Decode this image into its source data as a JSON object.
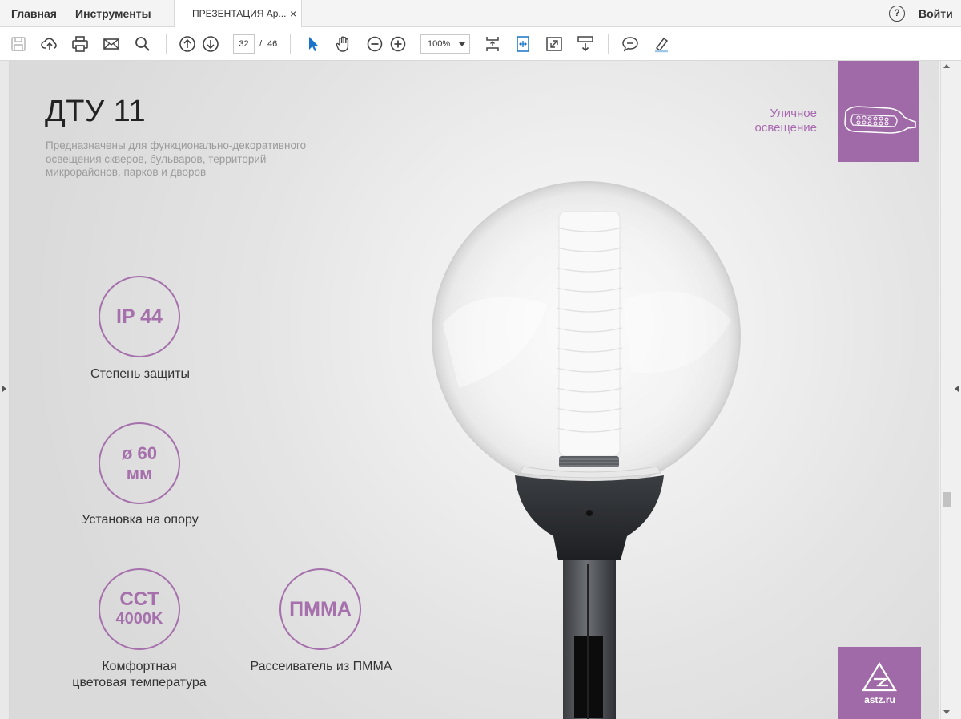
{
  "tabs": {
    "home": "Главная",
    "tools": "Инструменты",
    "document": "ПРЕЗЕНТАЦИЯ Ар...",
    "close": "×",
    "help": "?",
    "signin": "Войти"
  },
  "toolbar": {
    "page_current": "32",
    "page_separator": "/",
    "page_total": "46",
    "zoom": "100%",
    "accent_color": "#1a73c9"
  },
  "page": {
    "title": "ДТУ 11",
    "description": "Предназначены для функционально-декоративного освещения скверов, бульваров, территорий микрорайонов, парков и дворов",
    "category_line1": "Уличное",
    "category_line2": "освещение",
    "logo_text": "astz.ru",
    "accent_color": "#a06aa8"
  },
  "features": [
    {
      "lines": [
        "IP 44"
      ],
      "label": "Степень защиты"
    },
    {
      "lines": [
        "ø 60",
        "мм"
      ],
      "label": "Установка на опору"
    },
    {
      "lines": [
        "CCT",
        "4000K"
      ],
      "label_line1": "Комфортная",
      "label_line2": "цветовая температура"
    },
    {
      "lines": [
        "ПММА"
      ],
      "label": "Рассеиватель из ПММА"
    }
  ]
}
